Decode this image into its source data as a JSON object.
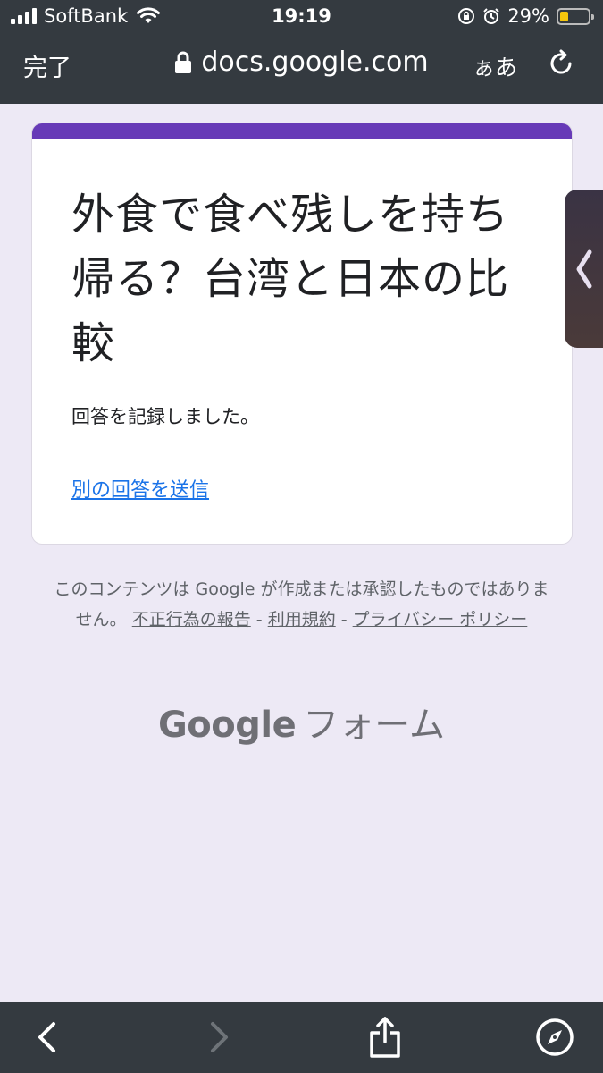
{
  "status_bar": {
    "carrier": "SoftBank",
    "time": "19:19",
    "battery": "29%",
    "battery_level": 0.29
  },
  "browser": {
    "done_label": "完了",
    "url": "docs.google.com",
    "text_size_label": "ぁあ"
  },
  "form": {
    "title": "外食で食べ残しを持ち帰る？台湾と日本の比較",
    "confirmation": "回答を記録しました。",
    "submit_another": "別の回答を送信",
    "accent_color": "#673ab7"
  },
  "footer": {
    "disclaimer_prefix": "このコンテンツは Google が作成または承認したものではありません。",
    "report_abuse": "不正行為の報告",
    "separator1": " - ",
    "terms": "利用規約",
    "separator2": " - ",
    "privacy": "プライバシー ポリシー",
    "brand_google": "Google",
    "brand_forms": "フォーム"
  },
  "icons": {
    "back": "chevron-left-icon",
    "forward": "chevron-right-icon",
    "share": "share-icon",
    "compass": "compass-icon",
    "side_tab": "chevron-left-icon"
  }
}
